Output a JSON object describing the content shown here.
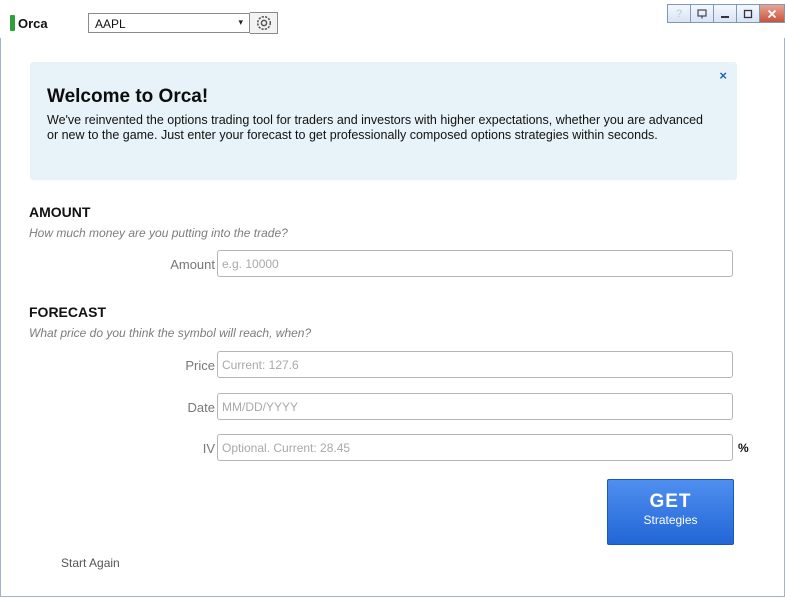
{
  "app": {
    "name": "Orca",
    "brand_color": "#2ca03a"
  },
  "toolbar": {
    "symbol": "AAPL",
    "symbol_caret": "▾",
    "settings_icon": "gear-icon"
  },
  "window_controls": {
    "help": "?",
    "restore_icon": "restore-icon",
    "minimize": "_",
    "maximize": "□",
    "close": "✕"
  },
  "welcome": {
    "title": "Welcome to Orca!",
    "body": "We've reinvented the options trading tool for traders and investors with higher expectations, whether you are advanced or new to the game. Just enter your forecast to get professionally composed options strategies within seconds.",
    "close": "×",
    "background": "#e8f3f9"
  },
  "amount": {
    "title": "AMOUNT",
    "subtitle": "How much money are you putting into the trade?",
    "label": "Amount",
    "placeholder": "e.g. 10000"
  },
  "forecast": {
    "title": "FORECAST",
    "subtitle": "What price do you think the symbol will reach, when?",
    "price_label": "Price",
    "price_placeholder": "Current: 127.6",
    "date_label": "Date",
    "date_placeholder": "MM/DD/YYYY",
    "iv_label": "IV",
    "iv_placeholder": "Optional. Current: 28.45",
    "iv_unit": "%"
  },
  "actions": {
    "get_main": "GET",
    "get_sub": "Strategies",
    "get_color": "#2f74e0",
    "start_again": "Start Again"
  }
}
